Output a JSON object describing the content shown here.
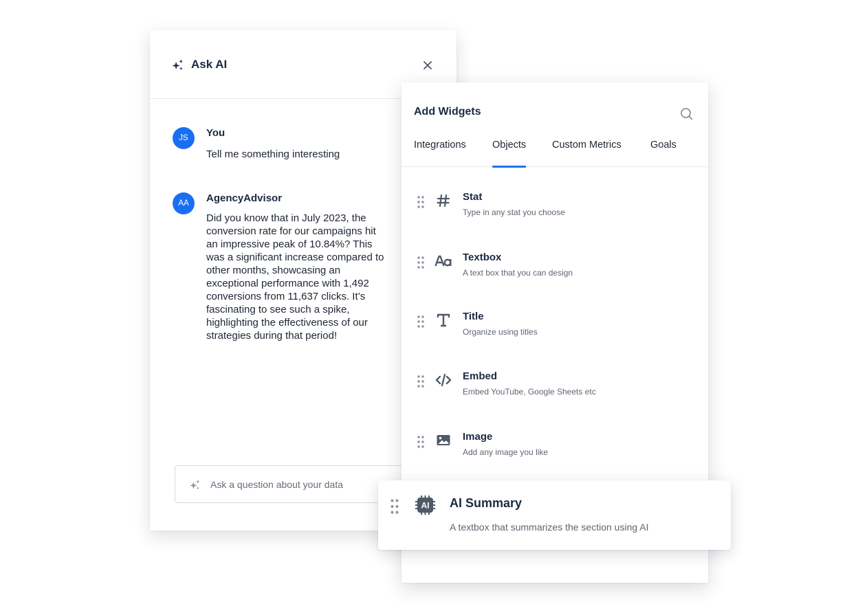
{
  "ask_ai": {
    "title": "Ask AI",
    "close_icon": "close-icon",
    "messages": [
      {
        "initials": "JS",
        "author": "You",
        "text": "Tell me something interesting"
      },
      {
        "initials": "AA",
        "author": "AgencyAdvisor",
        "text": "Did you know that in July 2023, the conversion rate for our campaigns hit an impressive peak of 10.84%? This was a significant increase compared to other months, showcasing an exceptional performance with 1,492 conversions from 11,637 clicks. It’s fascinating to see such a spike, highlighting the effectiveness of our strategies during that period!"
      }
    ],
    "input": {
      "placeholder": "Ask a question about your data",
      "value": ""
    }
  },
  "add_widgets": {
    "title": "Add Widgets",
    "search_icon": "search-icon",
    "tabs": [
      {
        "label": "Integrations",
        "active": false
      },
      {
        "label": "Objects",
        "active": true
      },
      {
        "label": "Custom Metrics",
        "active": false
      },
      {
        "label": "Goals",
        "active": false
      }
    ],
    "items": [
      {
        "icon": "hash-icon",
        "name": "Stat",
        "description": "Type in any stat you choose"
      },
      {
        "icon": "text-aa-icon",
        "name": "Textbox",
        "description": "A text box that you can design"
      },
      {
        "icon": "title-t-icon",
        "name": "Title",
        "description": "Organize using titles"
      },
      {
        "icon": "code-icon",
        "name": "Embed",
        "description": "Embed YouTube, Google Sheets etc"
      },
      {
        "icon": "image-icon",
        "name": "Image",
        "description": "Add any image you like"
      }
    ],
    "dragging_item": {
      "icon": "ai-chip-icon",
      "icon_text": "AI",
      "name": "AI Summary",
      "description": "A textbox that summarizes the section using AI"
    }
  },
  "colors": {
    "accent": "#1a73f0",
    "avatar": "#1a6ff0",
    "heading": "#1b2a41",
    "muted": "#5d6673",
    "icon": "#4f5a68"
  }
}
